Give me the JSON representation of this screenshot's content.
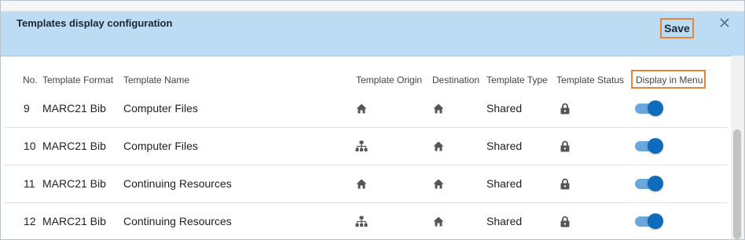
{
  "dialog": {
    "title": "Templates display configuration",
    "save_label": "Save",
    "close_icon": "close-icon"
  },
  "columns": {
    "no": "No.",
    "format": "Template Format",
    "name": "Template Name",
    "origin": "Template Origin",
    "destination": "Destination",
    "type": "Template Type",
    "status": "Template Status",
    "display": "Display in Menu"
  },
  "rows": [
    {
      "no": "9",
      "format": "MARC21 Bib",
      "name": "Computer Files",
      "origin_icon": "home-icon",
      "destination_icon": "home-icon",
      "type": "Shared",
      "status_icon": "lock-icon",
      "display_in_menu": true
    },
    {
      "no": "10",
      "format": "MARC21 Bib",
      "name": "Computer Files",
      "origin_icon": "network-icon",
      "destination_icon": "home-icon",
      "type": "Shared",
      "status_icon": "lock-icon",
      "display_in_menu": true
    },
    {
      "no": "11",
      "format": "MARC21 Bib",
      "name": "Continuing Resources",
      "origin_icon": "home-icon",
      "destination_icon": "home-icon",
      "type": "Shared",
      "status_icon": "lock-icon",
      "display_in_menu": true
    },
    {
      "no": "12",
      "format": "MARC21 Bib",
      "name": "Continuing Resources",
      "origin_icon": "network-icon",
      "destination_icon": "home-icon",
      "type": "Shared",
      "status_icon": "lock-icon",
      "display_in_menu": true
    }
  ],
  "colors": {
    "header_bg": "#bcdcf4",
    "highlight": "#e8843a",
    "toggle_on": "#0f6cbd"
  }
}
